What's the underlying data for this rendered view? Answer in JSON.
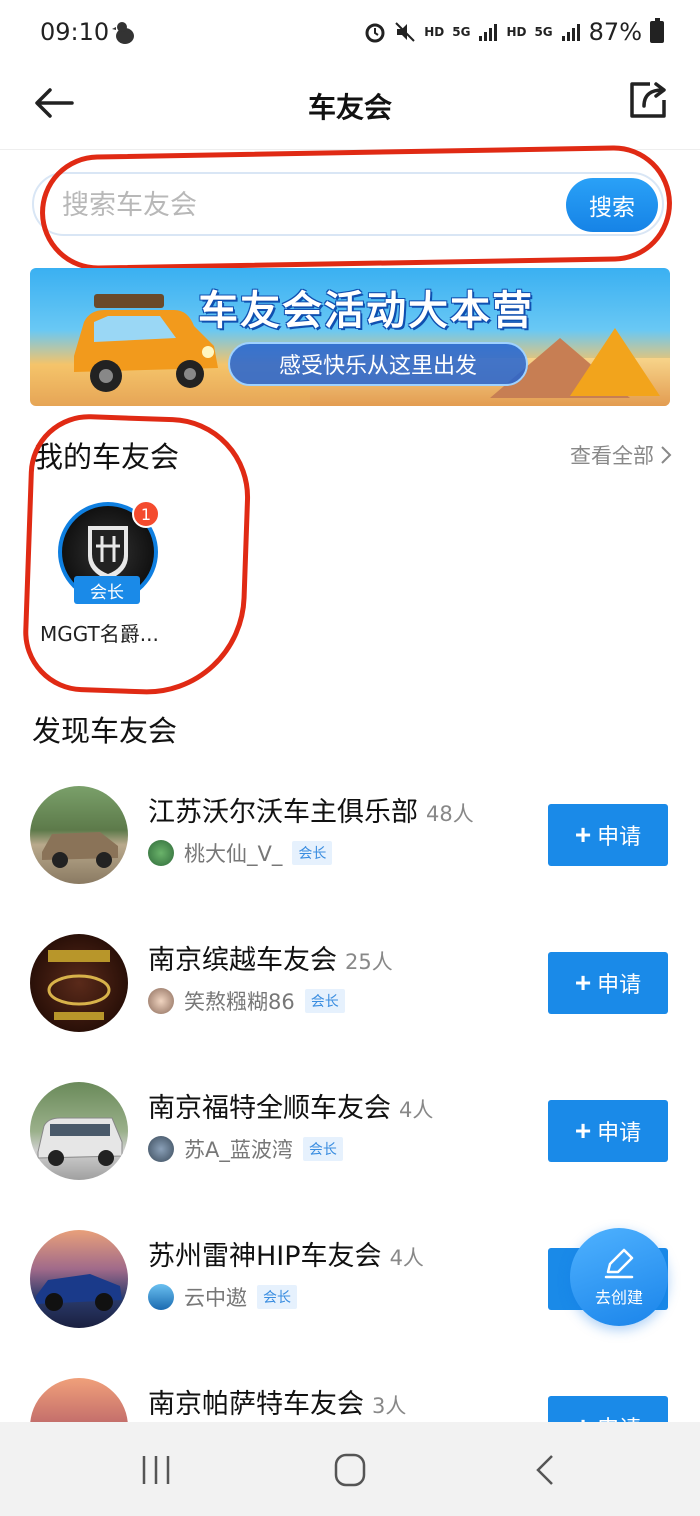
{
  "status_bar": {
    "time": "09:10",
    "net_hd1": "HD",
    "net_5g1": "5G",
    "net_hd2": "HD",
    "net_5g2": "5G",
    "battery": "87%"
  },
  "header": {
    "title": "车友会"
  },
  "search": {
    "placeholder": "搜索车友会",
    "button_label": "搜索"
  },
  "banner": {
    "headline": "车友会活动大本营",
    "tagline": "感受快乐从这里出发"
  },
  "my_clubs": {
    "title": "我的车友会",
    "see_all": "查看全部",
    "items": [
      {
        "name": "MGGT名爵...",
        "role": "会长",
        "unread": "1"
      }
    ]
  },
  "discover": {
    "title": "发现车友会",
    "apply_label": "申请",
    "items": [
      {
        "name": "江苏沃尔沃车主俱乐部",
        "count": "48人",
        "owner": "桃大仙_V_",
        "role": "会长"
      },
      {
        "name": "南京缤越车友会",
        "count": "25人",
        "owner": "笑熬糨糊86",
        "role": "会长"
      },
      {
        "name": "南京福特全顺车友会",
        "count": "4人",
        "owner": "苏A_蓝波湾",
        "role": "会长"
      },
      {
        "name": "苏州雷神HIP车友会",
        "count": "4人",
        "owner": "云中遨",
        "role": "会长"
      },
      {
        "name": "南京帕萨特车友会",
        "count": "3人"
      }
    ]
  },
  "fab": {
    "label": "去创建"
  },
  "colors": {
    "accent": "#1a8ae8",
    "annotation": "#e02a14",
    "badge": "#f44b2e"
  }
}
